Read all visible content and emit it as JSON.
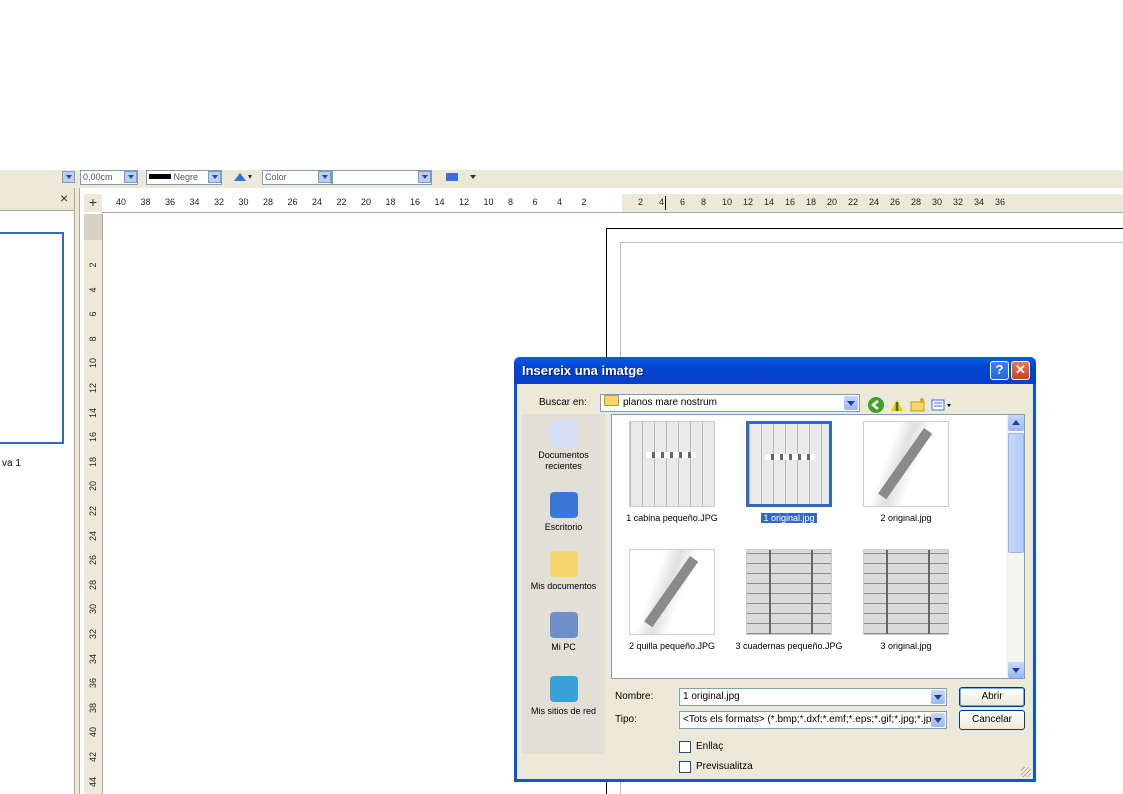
{
  "toolbar": {
    "line_width": "0,00cm",
    "line_color": "Negre",
    "fill_mode": "Color"
  },
  "left_panel": {
    "close_symbol": "×",
    "slide_label": "va 1"
  },
  "ruler": {
    "corner_symbol": "+",
    "horizontal_left": [
      "40",
      "38",
      "36",
      "34",
      "32",
      "30",
      "28",
      "26",
      "24",
      "22",
      "20",
      "18",
      "16",
      "14",
      "12",
      "10",
      "8",
      "6",
      "4",
      "2"
    ],
    "horizontal_right": [
      "2",
      "4",
      "6",
      "8",
      "10",
      "12",
      "14",
      "16",
      "18",
      "20",
      "22",
      "24",
      "26",
      "28",
      "30",
      "32",
      "34",
      "36"
    ],
    "vertical": [
      "2",
      "4",
      "6",
      "8",
      "10",
      "12",
      "14",
      "16",
      "18",
      "20",
      "22",
      "24",
      "26",
      "28",
      "30",
      "32",
      "34",
      "36",
      "38",
      "40",
      "42",
      "44"
    ]
  },
  "dialog": {
    "title": "Insereix una imatge",
    "help_symbol": "?",
    "close_symbol": "✕",
    "look_in_label": "Buscar en:",
    "look_in_value": "planos mare nostrum",
    "places": [
      {
        "label": "Documentos recientes",
        "icon": "recent-documents-icon"
      },
      {
        "label": "Escritorio",
        "icon": "desktop-icon"
      },
      {
        "label": "Mis documentos",
        "icon": "my-documents-icon"
      },
      {
        "label": "Mi PC",
        "icon": "my-computer-icon"
      },
      {
        "label": "Mis sitios de red",
        "icon": "network-places-icon"
      }
    ],
    "files": [
      {
        "name": "1 cabina pequeño.JPG",
        "selected": false
      },
      {
        "name": "1 original.jpg",
        "selected": true
      },
      {
        "name": "2 original.jpg",
        "selected": false
      },
      {
        "name": "2 quilla pequeño.JPG",
        "selected": false
      },
      {
        "name": "3 cuadernas pequeño.JPG",
        "selected": false
      },
      {
        "name": "3 original.jpg",
        "selected": false
      }
    ],
    "filename_label": "Nombre:",
    "filename_value": "1 original.jpg",
    "filetype_label": "Tipo:",
    "filetype_value": "<Tots els formats> (*.bmp;*.dxf;*.emf;*.eps;*.gif;*.jpg;*.jpe",
    "open_button": "Abrir",
    "cancel_button": "Cancelar",
    "link_checkbox": "Enllaç",
    "preview_checkbox": "Previsualitza"
  },
  "colors": {
    "title_bar": "#0855dd",
    "selection": "#316ac5",
    "dialog_bg": "#ece9d8"
  }
}
